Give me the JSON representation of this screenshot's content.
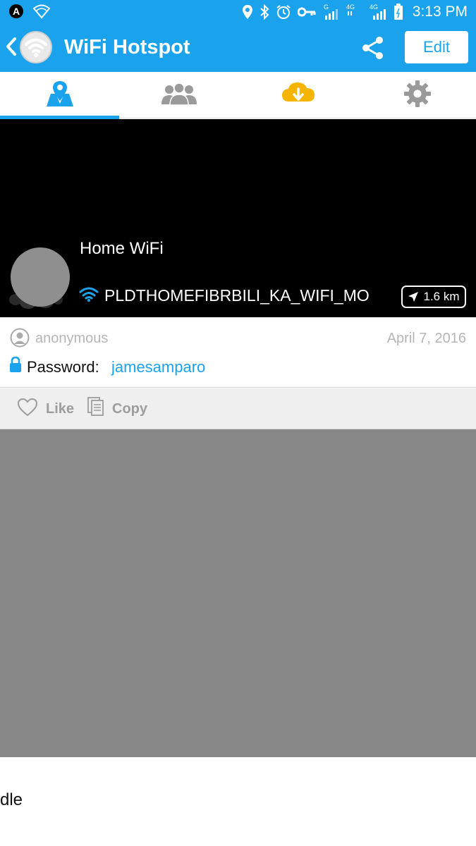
{
  "status_bar": {
    "time": "3:13 PM",
    "icons": [
      "app-a-icon",
      "wifi-question-icon",
      "location-icon",
      "bluetooth-icon",
      "alarm-icon",
      "key-icon",
      "signal-g-icon",
      "signal-4g-icon",
      "signal-4g-icon",
      "battery-icon"
    ],
    "signal_labels": [
      "G",
      "4G",
      "4G"
    ]
  },
  "app_bar": {
    "title": "WiFi Hotspot",
    "edit_label": "Edit",
    "color": "#1aa3ec"
  },
  "tabs": [
    {
      "icon": "map-pin-icon",
      "active": true,
      "color": "#1aa3ec"
    },
    {
      "icon": "people-icon",
      "active": false,
      "color": "#9a9a9a"
    },
    {
      "icon": "cloud-download-icon",
      "active": false,
      "color": "#f5b400"
    },
    {
      "icon": "gear-icon",
      "active": false,
      "color": "#9a9a9a"
    }
  ],
  "hotspot": {
    "name": "Home WiFi",
    "ssid": "PLDTHOMEFIBRBILI_KA_WIFI_MO",
    "distance": "1.6 km"
  },
  "post": {
    "username": "anonymous",
    "date": "April 7, 2016",
    "password_label": "Password:",
    "password_value": "jamesamparo"
  },
  "actions": {
    "like_label": "Like",
    "copy_label": "Copy"
  },
  "footer": {
    "partial_text": "dle"
  }
}
